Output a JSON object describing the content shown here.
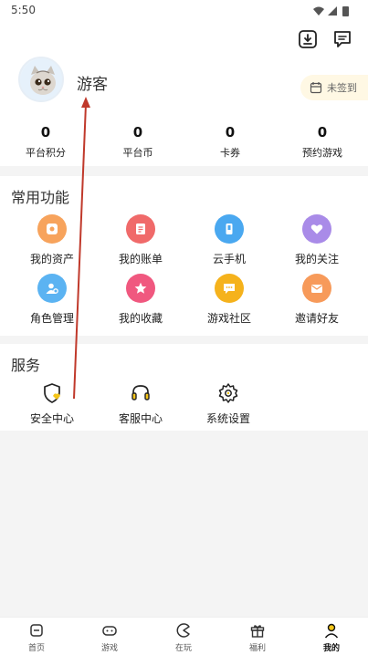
{
  "status": {
    "time": "5:50"
  },
  "profile": {
    "username": "游客",
    "checkin_label": "未签到"
  },
  "stats": [
    {
      "value": "0",
      "label": "平台积分"
    },
    {
      "value": "0",
      "label": "平台币"
    },
    {
      "value": "0",
      "label": "卡券"
    },
    {
      "value": "0",
      "label": "预约游戏"
    }
  ],
  "features": {
    "title": "常用功能",
    "items": [
      {
        "label": "我的资产",
        "icon": "asset-icon",
        "color": "#f7a35c"
      },
      {
        "label": "我的账单",
        "icon": "bill-icon",
        "color": "#f06a6a"
      },
      {
        "label": "云手机",
        "icon": "cloud-phone-icon",
        "color": "#4aa8f0"
      },
      {
        "label": "我的关注",
        "icon": "heart-icon",
        "color": "#a98be8"
      },
      {
        "label": "角色管理",
        "icon": "role-icon",
        "color": "#5bb3f2"
      },
      {
        "label": "我的收藏",
        "icon": "star-icon",
        "color": "#f0587f"
      },
      {
        "label": "游戏社区",
        "icon": "community-icon",
        "color": "#f5b21c"
      },
      {
        "label": "邀请好友",
        "icon": "invite-icon",
        "color": "#f79a5a"
      }
    ]
  },
  "services": {
    "title": "服务",
    "items": [
      {
        "label": "安全中心",
        "icon": "shield-icon"
      },
      {
        "label": "客服中心",
        "icon": "headset-icon"
      },
      {
        "label": "系统设置",
        "icon": "gear-icon"
      }
    ]
  },
  "tabbar": [
    {
      "label": "首页",
      "icon": "home-icon"
    },
    {
      "label": "游戏",
      "icon": "gamepad-icon"
    },
    {
      "label": "在玩",
      "icon": "playing-icon"
    },
    {
      "label": "福利",
      "icon": "gift-icon"
    },
    {
      "label": "我的",
      "icon": "profile-icon",
      "active": true
    }
  ],
  "colors": {
    "accent": "#f5c518",
    "annotation_arrow": "#c0392b"
  }
}
